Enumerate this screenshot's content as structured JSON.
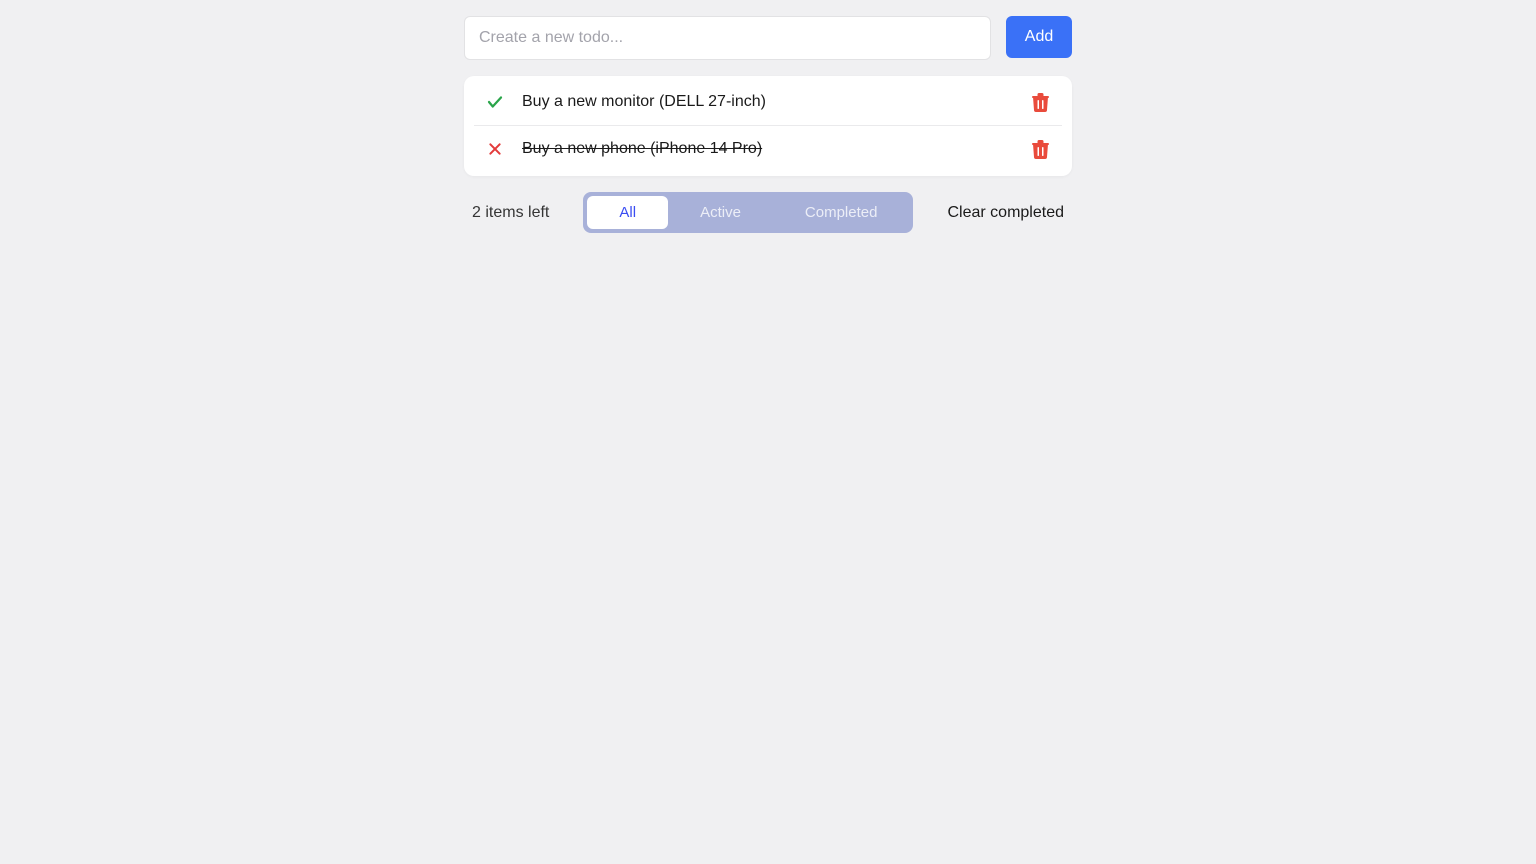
{
  "input": {
    "placeholder": "Create a new todo...",
    "value": ""
  },
  "add_button_label": "Add",
  "todos": [
    {
      "text": "Buy a new monitor (DELL 27-inch)",
      "completed": false
    },
    {
      "text": "Buy a new phone (iPhone 14 Pro)",
      "completed": true
    }
  ],
  "footer": {
    "items_left": "2 items left",
    "clear_label": "Clear completed"
  },
  "filters": {
    "all": "All",
    "active": "Active",
    "completed": "Completed",
    "selected": "all"
  },
  "colors": {
    "check": "#2aa54a",
    "cross": "#e33b3b",
    "trash": "#e94b3c",
    "accent": "#3a71f7"
  }
}
